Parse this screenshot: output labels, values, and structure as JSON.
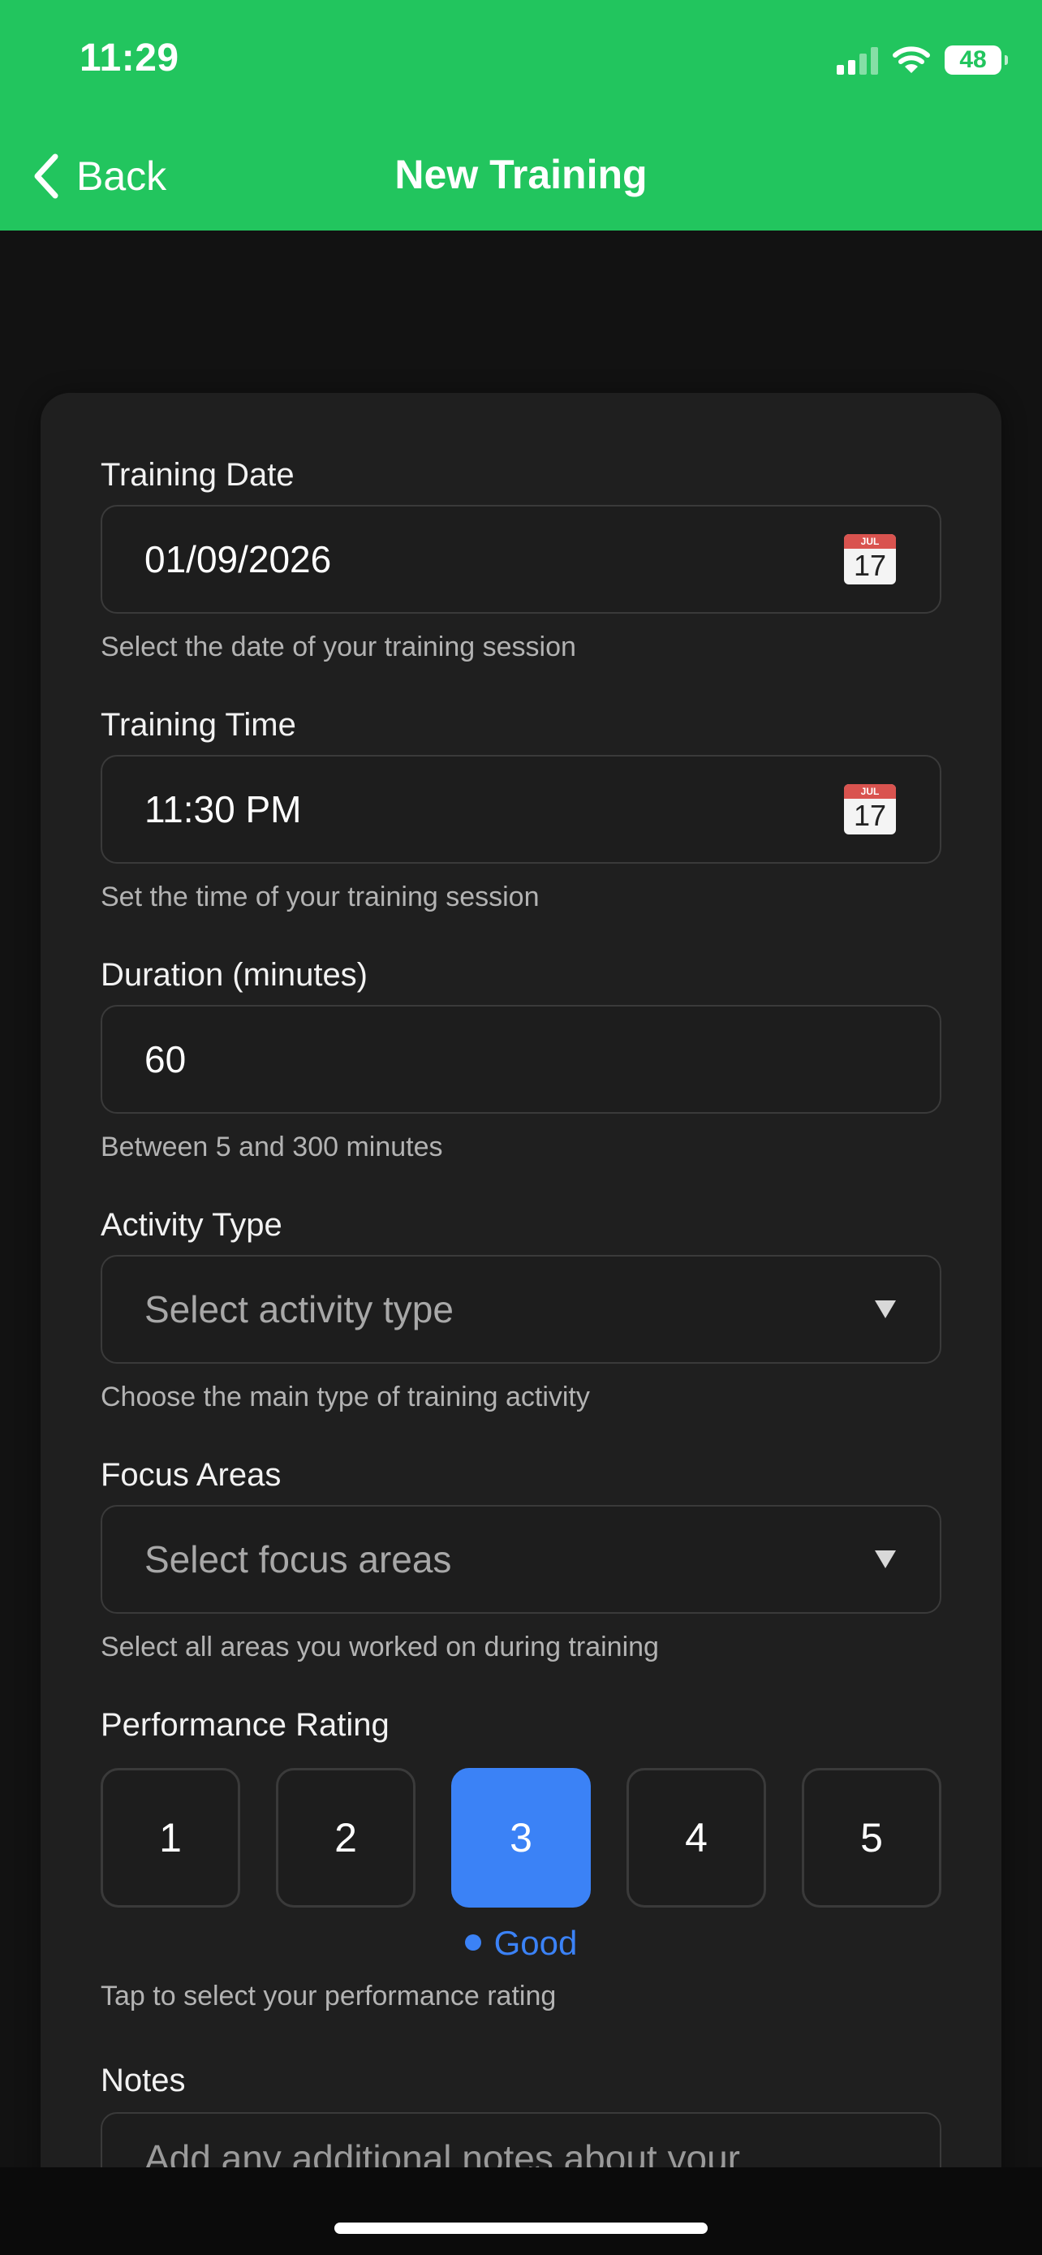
{
  "status_bar": {
    "time": "11:29",
    "battery": "48"
  },
  "nav": {
    "back_label": "Back",
    "title": "New Training"
  },
  "form": {
    "date": {
      "label": "Training Date",
      "value": "01/09/2026",
      "hint": "Select the date of your training session",
      "calendar_month": "JUL",
      "calendar_day": "17"
    },
    "time": {
      "label": "Training Time",
      "value": "11:30 PM",
      "hint": "Set the time of your training session",
      "calendar_month": "JUL",
      "calendar_day": "17"
    },
    "duration": {
      "label": "Duration (minutes)",
      "value": "60",
      "hint": "Between 5 and 300 minutes"
    },
    "activity": {
      "label": "Activity Type",
      "placeholder": "Select activity type",
      "hint": "Choose the main type of training activity"
    },
    "focus": {
      "label": "Focus Areas",
      "placeholder": "Select focus areas",
      "hint": "Select all areas you worked on during training"
    },
    "rating": {
      "label": "Performance Rating",
      "options": [
        "1",
        "2",
        "3",
        "4",
        "5"
      ],
      "selected": "3",
      "selected_text": "Good",
      "hint": "Tap to select your performance rating"
    },
    "notes": {
      "label": "Notes",
      "placeholder": "Add any additional notes about your"
    }
  },
  "colors": {
    "header": "#22c55e",
    "accent": "#3b82f6",
    "background": "#121212",
    "card": "#1f1f1f"
  }
}
